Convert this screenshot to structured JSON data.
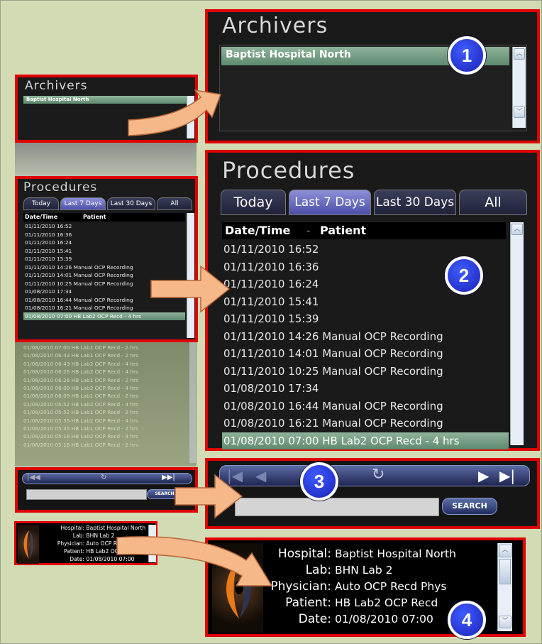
{
  "archivers": {
    "title": "Archivers",
    "items": [
      "Baptist Hospital North"
    ]
  },
  "procedures": {
    "title": "Procedures",
    "tabs": [
      "Today",
      "Last 7 Days",
      "Last 30 Days",
      "All"
    ],
    "active_tab": "Last 7 Days",
    "columns": [
      "Date/Time",
      "Patient"
    ],
    "rows": [
      {
        "date": "01/11/2010 16:52",
        "patient": ""
      },
      {
        "date": "01/11/2010 16:36",
        "patient": ""
      },
      {
        "date": "01/11/2010 16:24",
        "patient": ""
      },
      {
        "date": "01/11/2010 15:41",
        "patient": ""
      },
      {
        "date": "01/11/2010 15:39",
        "patient": ""
      },
      {
        "date": "01/11/2010 14:26",
        "patient": "Manual OCP Recording"
      },
      {
        "date": "01/11/2010 14:01",
        "patient": "Manual OCP Recording"
      },
      {
        "date": "01/11/2010 10:25",
        "patient": "Manual OCP Recording"
      },
      {
        "date": "01/08/2010 17:34",
        "patient": ""
      },
      {
        "date": "01/08/2010 16:44",
        "patient": "Manual OCP Recording"
      },
      {
        "date": "01/08/2010 16:21",
        "patient": "Manual OCP Recording"
      },
      {
        "date": "01/08/2010 07:00",
        "patient": "HB Lab2 OCP Recd - 4 hrs"
      }
    ],
    "faded_rows": [
      "01/08/2010 07:00 HB Lab1 OCP Recd - 2 hrs",
      "01/08/2010 06:43 HB Lab1 OCP Recd - 2 hrs",
      "01/08/2010 06:43 HB Lab2 OCP Recd - 4 hrs",
      "01/08/2010 06:26 HB Lab2 OCP Recd - 4 hrs",
      "01/08/2010 06:26 HB Lab1 OCP Recd - 2 hrs",
      "01/08/2010 06:09 HB Lab2 OCP Recd - 4 hrs",
      "01/08/2010 06:09 HB Lab1 OCP Recd - 2 hrs",
      "01/08/2010 05:52 HB Lab2 OCP Recd - 4 hrs",
      "01/08/2010 05:52 HB Lab1 OCP Recd - 2 hrs",
      "01/08/2010 05:35 HB Lab2 OCP Recd - 4 hrs",
      "01/08/2010 05:35 HB Lab1 OCP Recd - 2 hrs",
      "01/08/2010 05:18 HB Lab2 OCP Recd - 4 hrs",
      "01/08/2010 05:18 HB Lab1 OCP Recd - 2 hrs"
    ]
  },
  "search": {
    "button": "SEARCH",
    "small_button": "SEARCH",
    "value": ""
  },
  "info": {
    "labels": [
      "Hospital:",
      "Lab:",
      "Physician:",
      "Patient:",
      "Date:"
    ],
    "values": [
      "Baptist Hospital North",
      "BHN Lab 2",
      "Auto OCP Recd Phys",
      "HB Lab2 OCP Recd",
      "01/08/2010 07:00"
    ],
    "small_values": [
      "Baptist Hospital North",
      "BHN Lab 2",
      "Auto OCP Recd Physicia",
      "HB Lab2 OCP Recd - 4",
      "01/08/2010 07:00"
    ]
  },
  "callouts": [
    "1",
    "2",
    "3",
    "4"
  ],
  "colors": {
    "highlight": "#e00000",
    "selected_row": "#6f9a80",
    "tab_active": "#6e70c8"
  }
}
